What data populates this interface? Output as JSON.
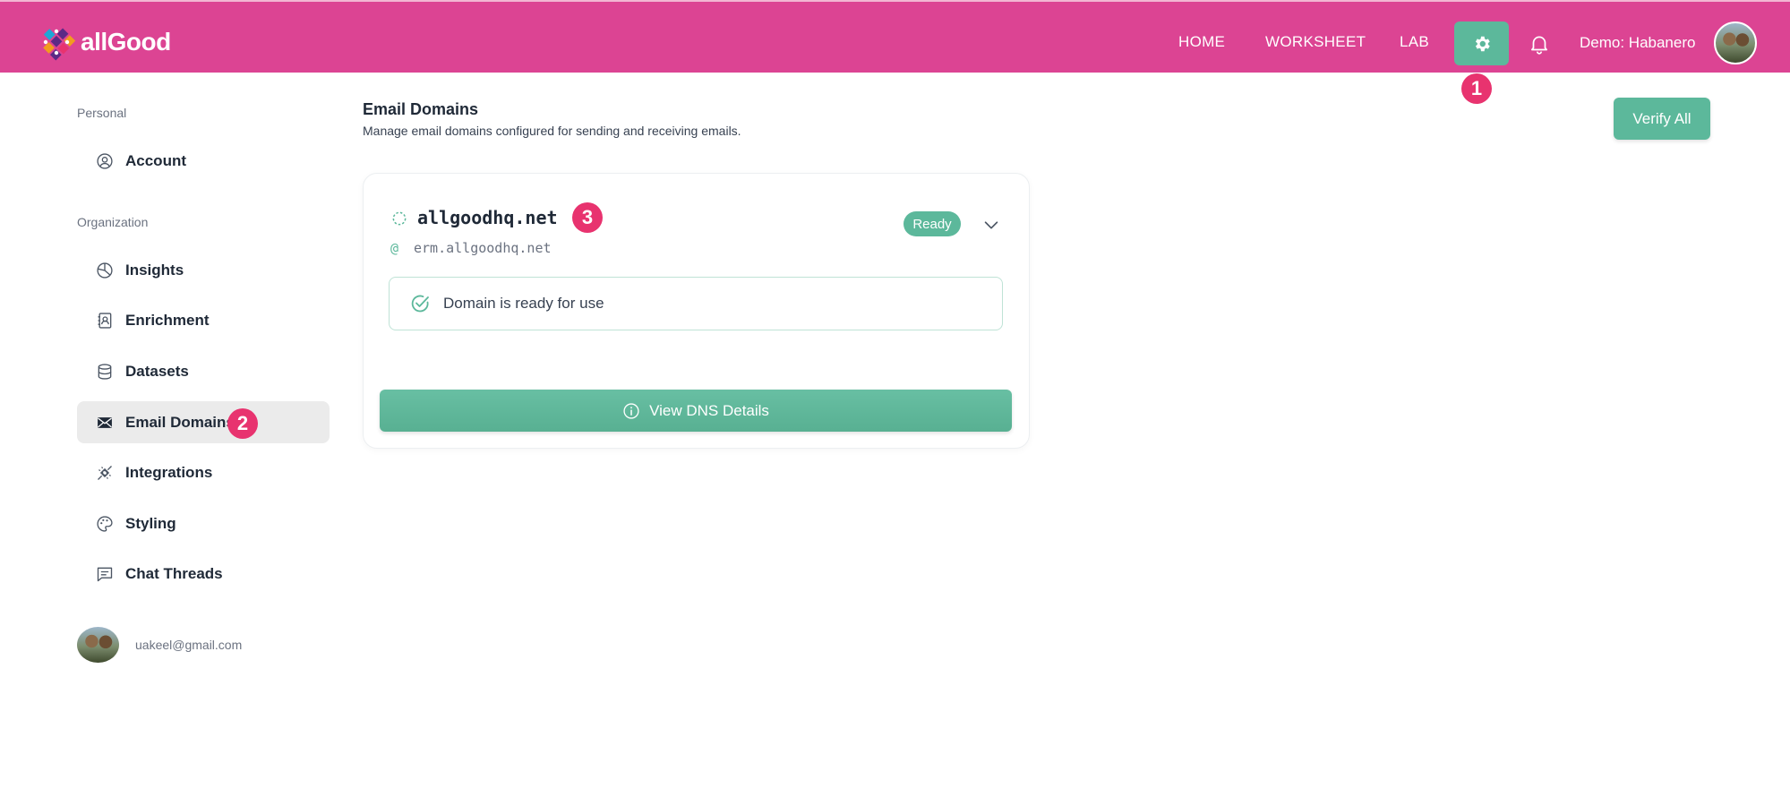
{
  "brand": {
    "name": "allGood"
  },
  "nav": {
    "home": "HOME",
    "worksheet": "WORKSHEET",
    "lab": "LAB",
    "user": "Demo: Habanero"
  },
  "annotations": {
    "one": "1",
    "two": "2",
    "three": "3"
  },
  "sidebar": {
    "personal_label": "Personal",
    "organization_label": "Organization",
    "items": [
      {
        "label": "Account",
        "icon": "user-circle-icon"
      },
      {
        "label": "Insights",
        "icon": "pie-chart-icon"
      },
      {
        "label": "Enrichment",
        "icon": "contact-book-icon"
      },
      {
        "label": "Datasets",
        "icon": "database-icon"
      },
      {
        "label": "Email Domains",
        "icon": "envelope-icon",
        "active": true
      },
      {
        "label": "Integrations",
        "icon": "plug-icon"
      },
      {
        "label": "Styling",
        "icon": "palette-icon"
      },
      {
        "label": "Chat Threads",
        "icon": "chat-icon"
      }
    ],
    "footer_email": "uakeel@gmail.com"
  },
  "main": {
    "title": "Email Domains",
    "subtitle": "Manage email domains configured for sending and receiving emails.",
    "verify_all": "Verify All",
    "domain": {
      "name": "allgoodhq.net",
      "at_symbol": "@",
      "sub": "erm.allgoodhq.net",
      "status": "Ready",
      "status_message": "Domain is ready for use",
      "dns_button": "View DNS Details"
    }
  },
  "colors": {
    "topbar": "#dc4493",
    "accent": "#5cb89b",
    "annotation": "#e8336f"
  }
}
